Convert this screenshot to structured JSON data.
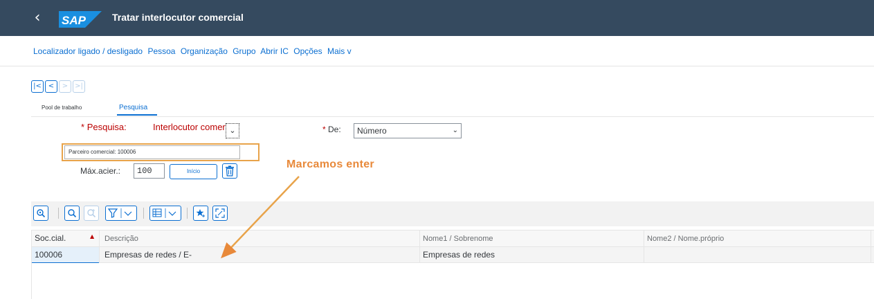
{
  "shell": {
    "back_glyph": "‹",
    "logo_text": "SAP",
    "title": "Tratar interlocutor comercial"
  },
  "menu": {
    "items": [
      "Localizador ligado / desligado",
      "Pessoa",
      "Organização",
      "Grupo",
      "Abrir IC",
      "Opções",
      "Mais v"
    ]
  },
  "nav": {
    "first": "|<",
    "prev": "<",
    "next": ">",
    "last": ">|"
  },
  "tabs": {
    "pool": "Pool de trabalho",
    "pesquisa": "Pesquisa"
  },
  "form": {
    "search_req": "*",
    "search_label": "Pesquisa:",
    "search_value": "Interlocutor comercial",
    "de_req": "*",
    "de_label": "De:",
    "de_value": "Número",
    "bp_value": "Parceiro comercial: 100006",
    "max_label": "Máx.acier.:",
    "max_value": "100",
    "inicio": "Início"
  },
  "annotation": "Marcamos enter",
  "table": {
    "headers": [
      "Soc.cial.",
      "Descrição",
      "Nome1 / Sobrenome",
      "Nome2 / Nome.próprio"
    ],
    "rows": [
      [
        "100006",
        "Empresas de redes / E-",
        "Empresas de redes",
        ""
      ]
    ]
  },
  "colors": {
    "shell": "#354a5f",
    "accent": "#0a6ed1",
    "annotation": "#e8893a",
    "required": "#bb0000"
  }
}
